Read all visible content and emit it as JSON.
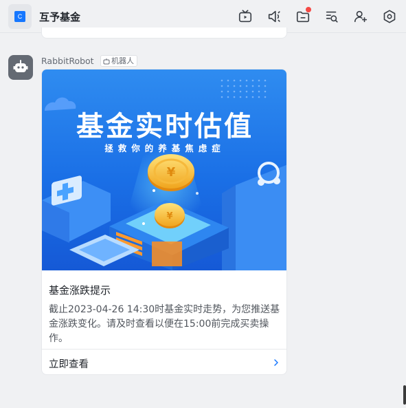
{
  "header": {
    "avatar_letter": "C",
    "title": "互予基金"
  },
  "message": {
    "sender": "RabbitRobot",
    "tag": "机器人",
    "card": {
      "banner_title": "基金实时估值",
      "banner_subtitle": "拯救你的养基焦虑症",
      "title": "基金涨跌提示",
      "body": "截止2023-04-26 14:30时基金实时走势，为您推送基金涨跌变化。请及时查看以便在15:00前完成买卖操作。",
      "action_label": "立即查看"
    }
  },
  "colors": {
    "accent": "#1677ff",
    "badge": "#f54a45",
    "banner": "#1a6fe6"
  },
  "icons": [
    "live-tv-icon",
    "announcement-icon",
    "folder-icon",
    "search-list-icon",
    "add-member-icon",
    "settings-icon"
  ]
}
